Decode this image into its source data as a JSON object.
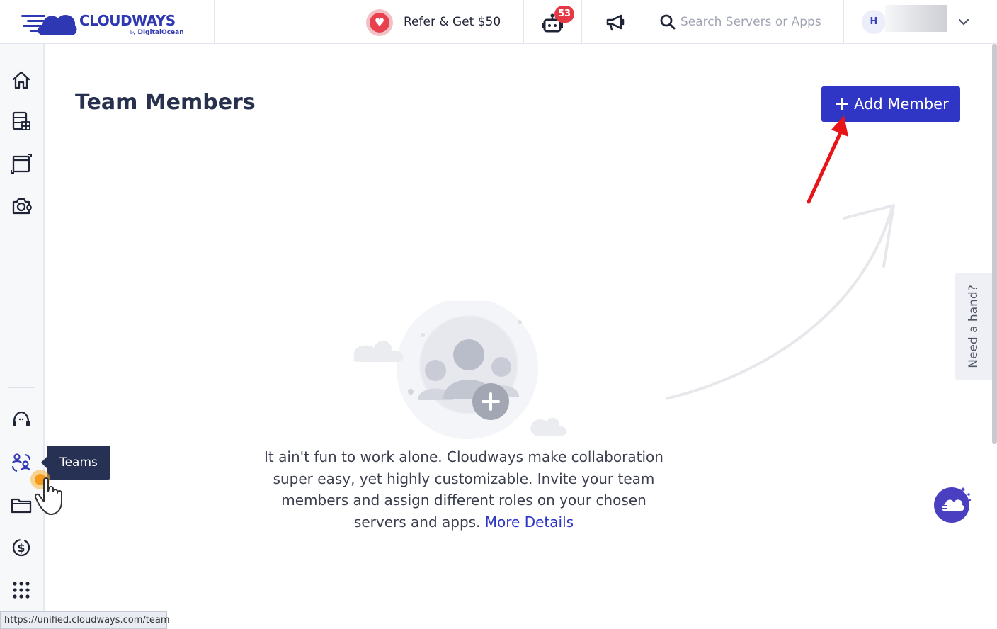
{
  "header": {
    "logo_text": "CLOUDWAYS",
    "logo_sub_by": "by",
    "logo_sub": "DigitalOcean",
    "refer_label": "Refer & Get $50",
    "notification_count": "53",
    "search_placeholder": "Search Servers or Apps",
    "avatar_initial": "H"
  },
  "sidebar": {
    "tooltip": "Teams"
  },
  "main": {
    "title": "Team Members",
    "add_button_plus": "+",
    "add_button_label": "Add Member",
    "description": "It ain't fun to work alone. Cloudways make collaboration super easy, yet highly customizable. Invite your team members and assign different roles on your chosen servers and apps.",
    "more_details": "More Details"
  },
  "need_hand": "Need a hand?",
  "status_url": "https://unified.cloudways.com/team",
  "colors": {
    "brand": "#2f35c4",
    "badge": "#e53945",
    "tooltip_bg": "#263154",
    "annotation_arrow": "#e81418"
  }
}
